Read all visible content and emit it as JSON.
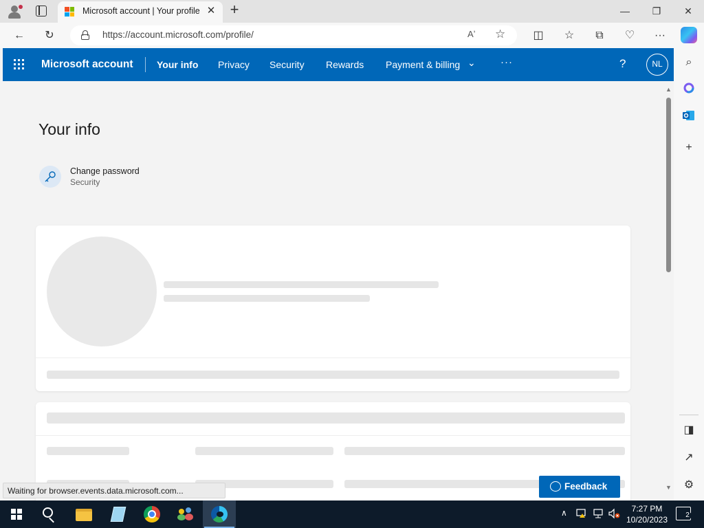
{
  "browser": {
    "tab_title": "Microsoft account | Your profile",
    "tab_close": "✕",
    "new_tab": "+",
    "url": "https://account.microsoft.com/profile/",
    "window_controls": {
      "minimize": "—",
      "restore": "❐",
      "close": "✕"
    },
    "toolbar": {
      "back": "←",
      "refresh": "↻",
      "read_aloud": "Aʼ",
      "favorite": "☆",
      "split": "◫",
      "favorites": "☆",
      "collections": "⧉",
      "performance": "♡",
      "more": "···"
    },
    "sidebar": {
      "search": "⌕",
      "add": "+",
      "panel": "◨",
      "open_external": "↗",
      "settings": "⚙"
    },
    "status_text": "Waiting for browser.events.data.microsoft.com..."
  },
  "header": {
    "brand": "Microsoft account",
    "nav": [
      "Your info",
      "Privacy",
      "Security",
      "Rewards",
      "Payment & billing"
    ],
    "chevron": "⌄",
    "more": "···",
    "help": "?",
    "avatar_initials": "NL"
  },
  "main": {
    "title": "Your info",
    "change_password": {
      "title": "Change password",
      "subtitle": "Security"
    }
  },
  "feedback_label": "Feedback",
  "taskbar": {
    "time": "7:27 PM",
    "date": "10/20/2023",
    "notifications": "2",
    "tray_chevron": "∧"
  },
  "colors": {
    "accent": "#0067b8",
    "taskbar": "#0d1b2a",
    "page_bg": "#f3f3f3",
    "skeleton": "#e6e6e6"
  },
  "icons": [
    "profile-icon",
    "tab-actions-icon",
    "microsoft-logo-icon",
    "lock-icon",
    "key-icon",
    "waffle-icon",
    "help-icon",
    "feedback-icon",
    "windows-start-icon",
    "search-icon",
    "file-explorer-icon",
    "notepad-icon",
    "chrome-icon",
    "users-icon",
    "edge-icon",
    "copilot-icon",
    "outlook-icon",
    "office-icon"
  ]
}
